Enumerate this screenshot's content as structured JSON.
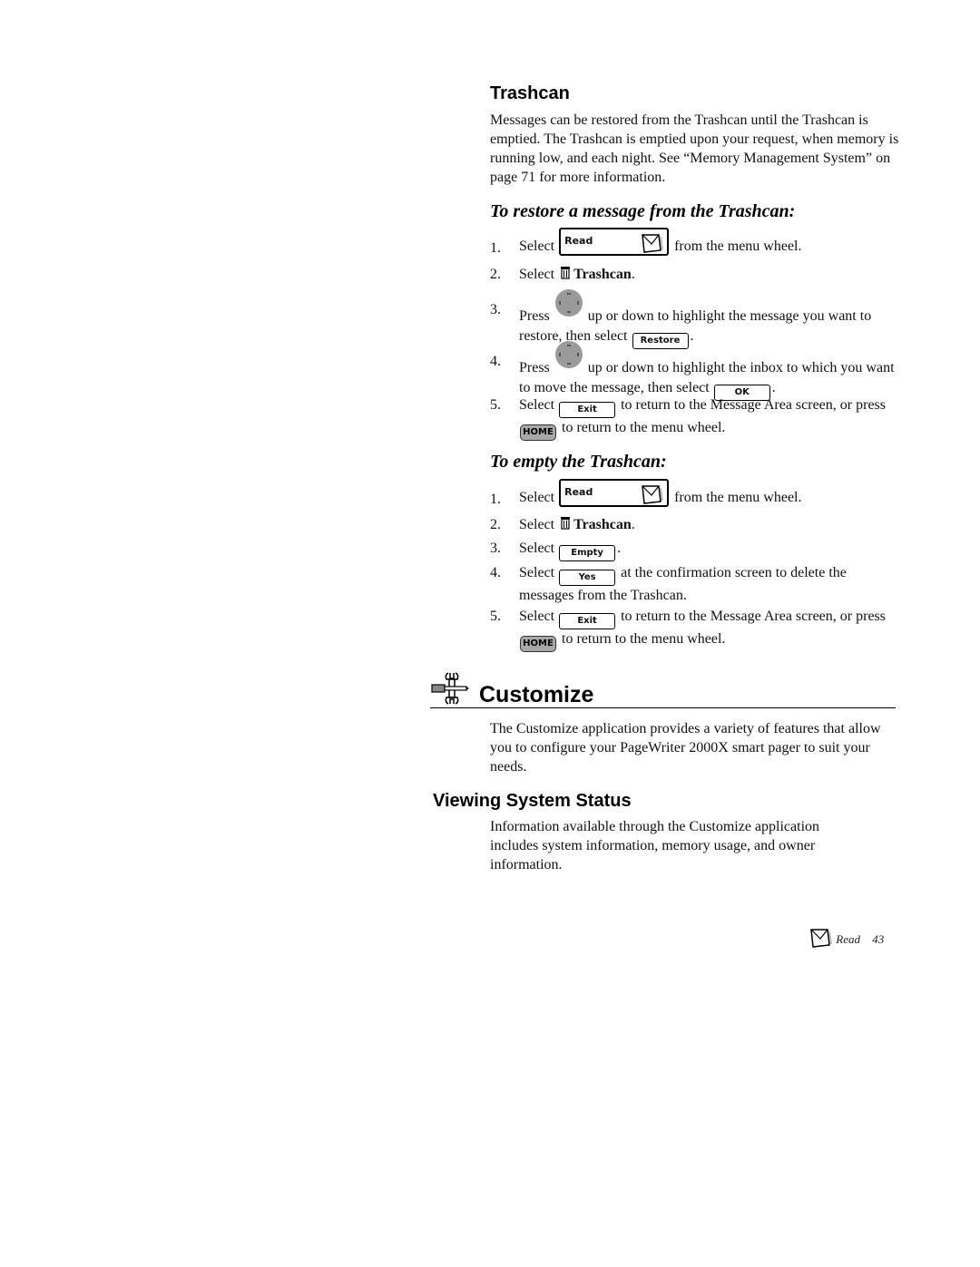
{
  "trashcan": {
    "heading": "Trashcan",
    "intro": "Messages can be restored from the Trashcan until the Trashcan is emptied. The Trashcan is emptied upon your request, when memory is running low, and each night. See “Memory Management System” on page 71 for more information."
  },
  "restore": {
    "heading": "To restore a message from the Trashcan:",
    "steps": [
      {
        "num": "1.",
        "pre": "Select",
        "button": "Read",
        "post": "from the menu wheel."
      },
      {
        "num": "2.",
        "pre": "Select",
        "bold": "Trashcan",
        "post": "."
      },
      {
        "num": "3.",
        "pre": "Press",
        "mid": "up or down to highlight the message you want to restore, then select",
        "button": "Restore",
        "post": "."
      },
      {
        "num": "4.",
        "pre": "Press",
        "mid": "up or down to highlight the inbox to which you want to move the message, then select",
        "button": "OK",
        "post": "."
      },
      {
        "num": "5.",
        "pre": "Select",
        "button": "Exit",
        "mid": "to return to the Message Area screen, or press",
        "home": "HOME",
        "post": "to return to the menu wheel."
      }
    ]
  },
  "empty": {
    "heading": "To empty the Trashcan:",
    "steps": [
      {
        "num": "1.",
        "pre": "Select",
        "button": "Read",
        "post": "from the menu wheel."
      },
      {
        "num": "2.",
        "pre": "Select",
        "bold": "Trashcan",
        "post": "."
      },
      {
        "num": "3.",
        "pre": "Select",
        "button": "Empty",
        "post": "."
      },
      {
        "num": "4.",
        "pre": "Select",
        "button": "Yes",
        "post": "at the confirmation screen to delete the messages from the Trashcan."
      },
      {
        "num": "5.",
        "pre": "Select",
        "button": "Exit",
        "mid": "to return to the Message Area screen, or press",
        "home": "HOME",
        "post": "to return to the menu wheel."
      }
    ]
  },
  "customize": {
    "heading": "Customize",
    "intro": "The Customize application provides a variety of features that allow you to configure your PageWriter 2000X smart pager to suit your needs."
  },
  "system_status": {
    "heading": "Viewing System Status",
    "text": "Information available through the Customize application includes system information, memory usage, and owner information."
  },
  "footer": {
    "section": "Read",
    "page": "43"
  }
}
